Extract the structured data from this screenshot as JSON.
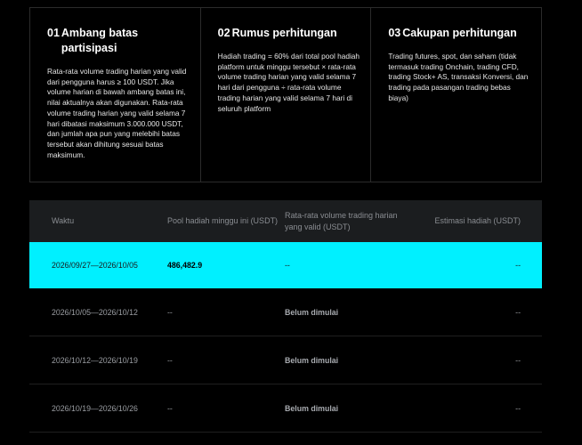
{
  "rules": [
    {
      "number": "01",
      "title": "Ambang batas partisipasi",
      "body": "Rata-rata volume trading harian yang valid dari pengguna harus ≥ 100 USDT. Jika volume harian di bawah ambang batas ini, nilai aktualnya akan digunakan. Rata-rata volume trading harian yang valid selama 7 hari dibatasi maksimum 3.000.000 USDT, dan jumlah apa pun yang melebihi batas tersebut akan dihitung sesuai batas maksimum."
    },
    {
      "number": "02",
      "title": "Rumus perhitungan",
      "body": "Hadiah trading = 60% dari total pool hadiah platform untuk minggu tersebut × rata-rata volume trading harian yang valid selama 7 hari dari pengguna ÷ rata-rata volume trading harian yang valid selama 7 hari di seluruh platform"
    },
    {
      "number": "03",
      "title": "Cakupan perhitungan",
      "body": "Trading futures, spot, dan saham (tidak termasuk trading Onchain, trading CFD, trading Stock+ AS, transaksi Konversi, dan trading pada pasangan trading bebas biaya)"
    }
  ],
  "table": {
    "headers": {
      "period": "Waktu",
      "pool": "Pool hadiah minggu ini (USDT)",
      "avg_volume": "Rata-rata volume trading harian yang valid (USDT)",
      "estimate": "Estimasi hadiah (USDT)"
    },
    "rows": [
      {
        "period": "2026/09/27—2026/10/05",
        "pool": "486,482.9",
        "avg_volume": "--",
        "estimate": "--"
      },
      {
        "period": "2026/10/05—2026/10/12",
        "pool": "--",
        "avg_volume": "Belum dimulai",
        "estimate": "--"
      },
      {
        "period": "2026/10/12—2026/10/19",
        "pool": "--",
        "avg_volume": "Belum dimulai",
        "estimate": "--"
      },
      {
        "period": "2026/10/19—2026/10/26",
        "pool": "--",
        "avg_volume": "Belum dimulai",
        "estimate": "--"
      }
    ]
  },
  "colors": {
    "background": "#000000",
    "active_row": "#00f0ff",
    "header_bg": "#1b1d1f",
    "border": "#2b2b2b"
  }
}
